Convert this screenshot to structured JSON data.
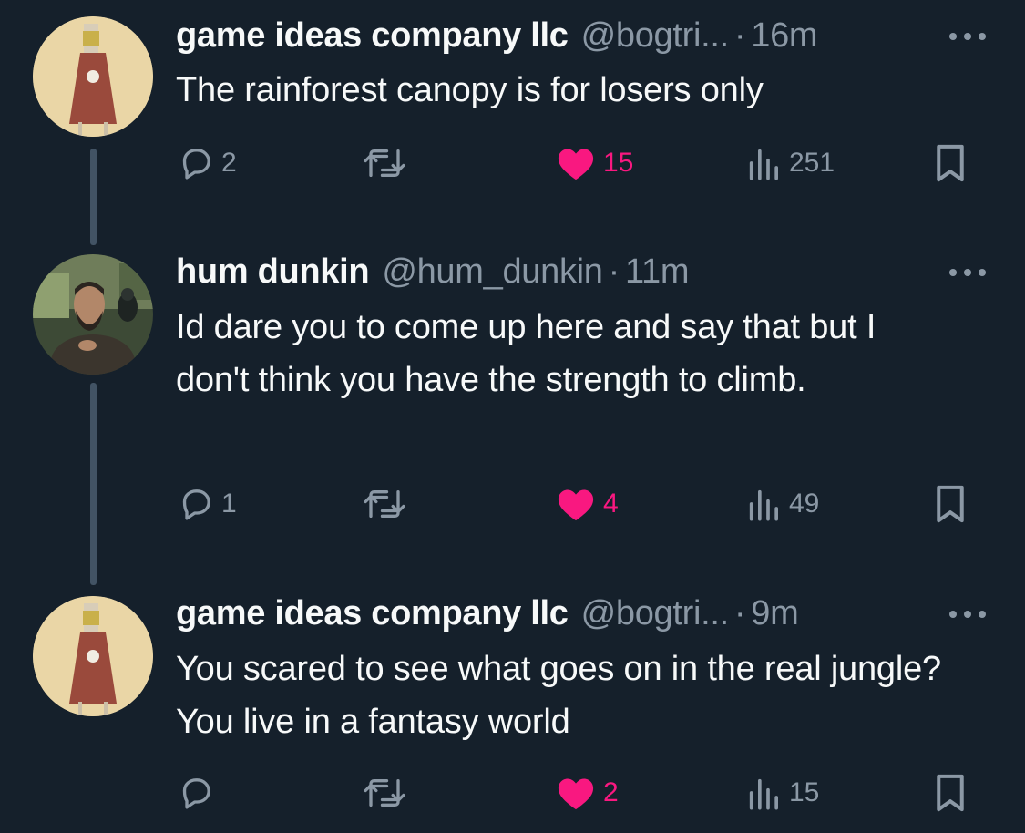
{
  "colors": {
    "background": "#15202b",
    "text": "#f7f9f9",
    "secondary": "#8b98a5",
    "like": "#f91880",
    "thread_line": "#425364"
  },
  "tweets": [
    {
      "name": "game ideas company llc",
      "handle": "@bogtri...",
      "separator": "·",
      "time": "16m",
      "text": "The rainforest canopy is for losers only",
      "replies": "2",
      "reposts": "",
      "likes": "15",
      "views": "251",
      "avatar": "figurine-avatar",
      "liked": true
    },
    {
      "name": "hum dunkin",
      "handle": "@hum_dunkin",
      "separator": "·",
      "time": "11m",
      "text": "Id dare you to come up here and say that but I don't think you have the strength to climb.",
      "replies": "1",
      "reposts": "",
      "likes": "4",
      "views": "49",
      "avatar": "man-with-parrot-avatar",
      "liked": true
    },
    {
      "name": "game ideas company llc",
      "handle": "@bogtri...",
      "separator": "·",
      "time": "9m",
      "text": "You scared to see what goes on in the real jungle? You live in a fantasy world",
      "replies": "",
      "reposts": "",
      "likes": "2",
      "views": "15",
      "avatar": "figurine-avatar",
      "liked": true
    }
  ],
  "icons": [
    "reply-icon",
    "repost-icon",
    "like-icon",
    "views-icon",
    "bookmark-icon",
    "more-icon"
  ]
}
